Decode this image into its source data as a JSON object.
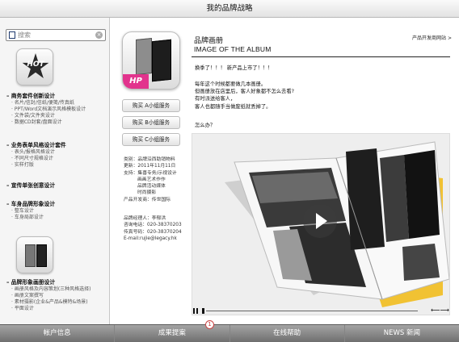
{
  "window": {
    "title": "我的品牌战略"
  },
  "search": {
    "placeholder": "搜索"
  },
  "sidebar": {
    "hot_label": "HOT",
    "sections": [
      {
        "title": "商务套件创新设计",
        "items": [
          "名片/信封/信纸/便笺/传真纸",
          "PPT/Word文档演示风格模板设计",
          "文件袋/文件夹设计",
          "数据CD封套/盘面设计"
        ]
      },
      {
        "title": "业务表单风格设计套件",
        "items": [
          "表头/报格风格设计",
          "不同尺寸规格设计",
          "实样打版"
        ]
      },
      {
        "title": "宣传单张创意设计",
        "items": []
      },
      {
        "title": "车身品牌形象设计",
        "items": [
          "整车设计",
          "车身局部设计"
        ]
      },
      {
        "title": "品牌形象画册设计",
        "items": [
          "画册风格及内容策划(三种风格选择)",
          "画册文案撰写",
          "素材摄影(企业&产品&模特&场景)",
          "平面设计"
        ]
      }
    ]
  },
  "product": {
    "badge": "HP",
    "buy_buttons": [
      "购买 A小组服务",
      "购买 B小组服务",
      "购买 C小组服务"
    ],
    "info_lines": [
      "类别：品牌沿西助销物料",
      "更新：2011年11月11日",
      "支持：集喜专务/示视设计",
      "画画艺术作作",
      "品牌活动媒体",
      "时尚摄影",
      "产品开发商：传世国际"
    ],
    "contact_lines": [
      "品牌经理人：李郁洪",
      "咨询电话：020-38370203",
      "传真号码：020-38370204",
      "E-mail:rujie@legacy.hk"
    ]
  },
  "content": {
    "title_cn": "品牌画册",
    "title_en": "IMAGE OF THE ALBUM",
    "catalog_link": "产品开发商网站",
    "paragraphs": [
      "换季了！！！ 新产品上市了！！！",
      "每年这个时候都要做几本画册。",
      "但画册放在店里后，客人好象都不怎么去看?",
      "有时派送给客人，",
      "客人也都随手当做废纸就丢掉了。",
      "怎么办？"
    ]
  },
  "tabbar": {
    "tabs": [
      "帐户信息",
      "成果提案",
      "在线帮助",
      "NEWS 新闻"
    ],
    "badge_count": "1"
  },
  "colors": {
    "accent_pink": "#e2338d",
    "book_yellow": "#f1c233",
    "tab_gray": "#8a8a8a"
  }
}
